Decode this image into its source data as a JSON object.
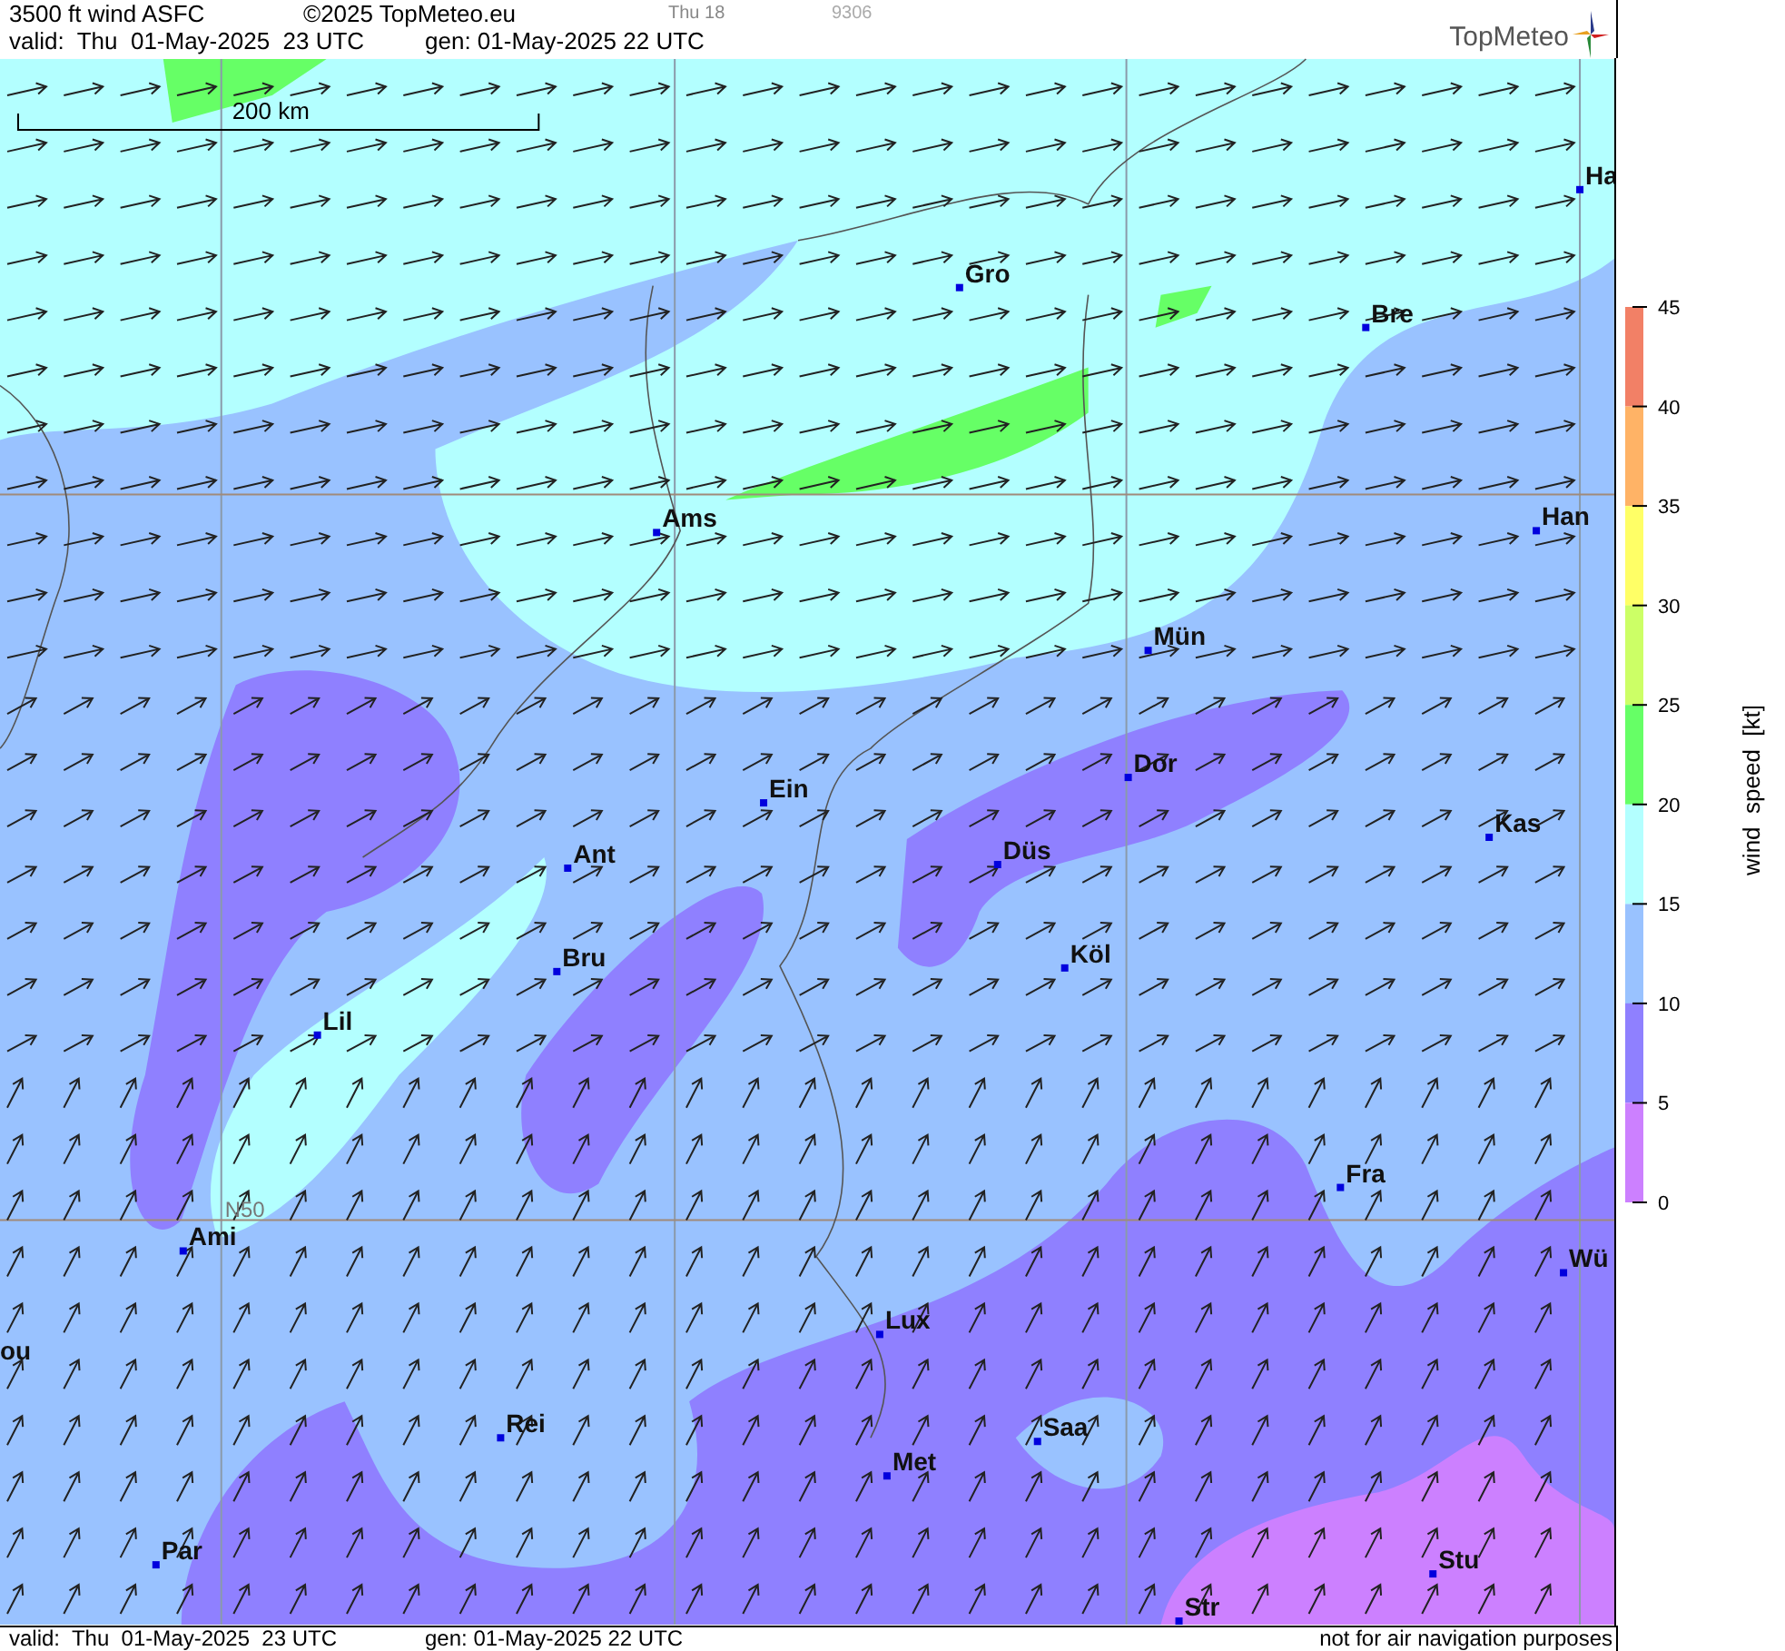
{
  "header": {
    "title": "3500 ft wind ASFC",
    "copyright": "©2025 TopMeteo.eu",
    "day_label": "Thu 18",
    "code": "9306",
    "valid": "valid:  Thu  01-May-2025  23 UTC",
    "generated": "gen: 01-May-2025 22 UTC",
    "logo": "TopMeteo"
  },
  "map": {
    "scale_label": "200 km",
    "grid_label": "N50",
    "cities": [
      {
        "name": "Gro"
      },
      {
        "name": "Ha"
      },
      {
        "name": "Bre"
      },
      {
        "name": "Ams"
      },
      {
        "name": "Han"
      },
      {
        "name": "Mün"
      },
      {
        "name": "Dor"
      },
      {
        "name": "Ein"
      },
      {
        "name": "Kas"
      },
      {
        "name": "Ant"
      },
      {
        "name": "Düs"
      },
      {
        "name": "Bru"
      },
      {
        "name": "Köl"
      },
      {
        "name": "Lil"
      },
      {
        "name": "Fra"
      },
      {
        "name": "Ami"
      },
      {
        "name": "Wü"
      },
      {
        "name": "Lux"
      },
      {
        "name": "ou"
      },
      {
        "name": "Rei"
      },
      {
        "name": "Saa"
      },
      {
        "name": "Met"
      },
      {
        "name": "Par"
      },
      {
        "name": "Stu"
      },
      {
        "name": "Str"
      }
    ]
  },
  "legend": {
    "title": "wind  speed  [kt]",
    "ticks": [
      "45",
      "40",
      "35",
      "30",
      "25",
      "20",
      "15",
      "10",
      "5",
      "0"
    ],
    "bands": [
      {
        "color": "#f28066"
      },
      {
        "color": "#ffb366"
      },
      {
        "color": "#ffff66"
      },
      {
        "color": "#ccff66"
      },
      {
        "color": "#66ff66"
      },
      {
        "color": "#b3ffff"
      },
      {
        "color": "#99c2ff"
      },
      {
        "color": "#8f80ff"
      },
      {
        "color": "#cc80ff"
      }
    ]
  },
  "footer": {
    "valid": "valid:  Thu  01-May-2025  23 UTC",
    "generated": "gen: 01-May-2025 22 UTC",
    "disclaimer": "not for air navigation purposes"
  }
}
